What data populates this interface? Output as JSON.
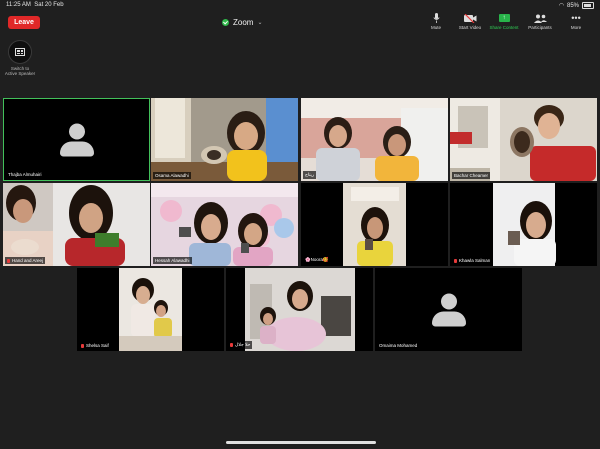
{
  "status_bar": {
    "time": "11:25 AM",
    "date": "Sat 20 Feb",
    "battery": "85%"
  },
  "header": {
    "leave_label": "Leave",
    "title": "Zoom"
  },
  "toolbar": [
    {
      "label": "Mute",
      "icon": "microphone-icon"
    },
    {
      "label": "Start Video",
      "icon": "video-off-icon"
    },
    {
      "label": "Share Content",
      "icon": "share-screen-icon"
    },
    {
      "label": "Participants",
      "icon": "participants-icon"
    },
    {
      "label": "More",
      "icon": "more-icon"
    }
  ],
  "speaker_switch": {
    "label_line1": "Switch to",
    "label_line2": "Active Speaker"
  },
  "participants": [
    {
      "name": "Thajba Almuhairi",
      "video": false,
      "active": true,
      "muted": false
    },
    {
      "name": "Osama Alawadhi",
      "video": true,
      "muted": false
    },
    {
      "name": "ريتاج",
      "video": true,
      "muted": false
    },
    {
      "name": "Bachar Cheamer",
      "video": true,
      "muted": false
    },
    {
      "name": "Hand and Areej",
      "video": true,
      "muted": true
    },
    {
      "name": "Hessah Alawadhi",
      "video": true,
      "muted": false
    },
    {
      "name": "🌸Noora🥰",
      "video": true,
      "muted": false
    },
    {
      "name": "Khawla Salman",
      "video": true,
      "muted": true
    },
    {
      "name": "Shelsa Saif",
      "video": true,
      "muted": true
    },
    {
      "name": "حلا جلال",
      "video": true,
      "muted": true
    },
    {
      "name": "Omaima Mohamed",
      "video": false,
      "muted": false
    }
  ],
  "colors": {
    "leave": "#e02828",
    "active_border": "#42c05a",
    "share": "#28b34a",
    "background": "#1f1f1f"
  }
}
